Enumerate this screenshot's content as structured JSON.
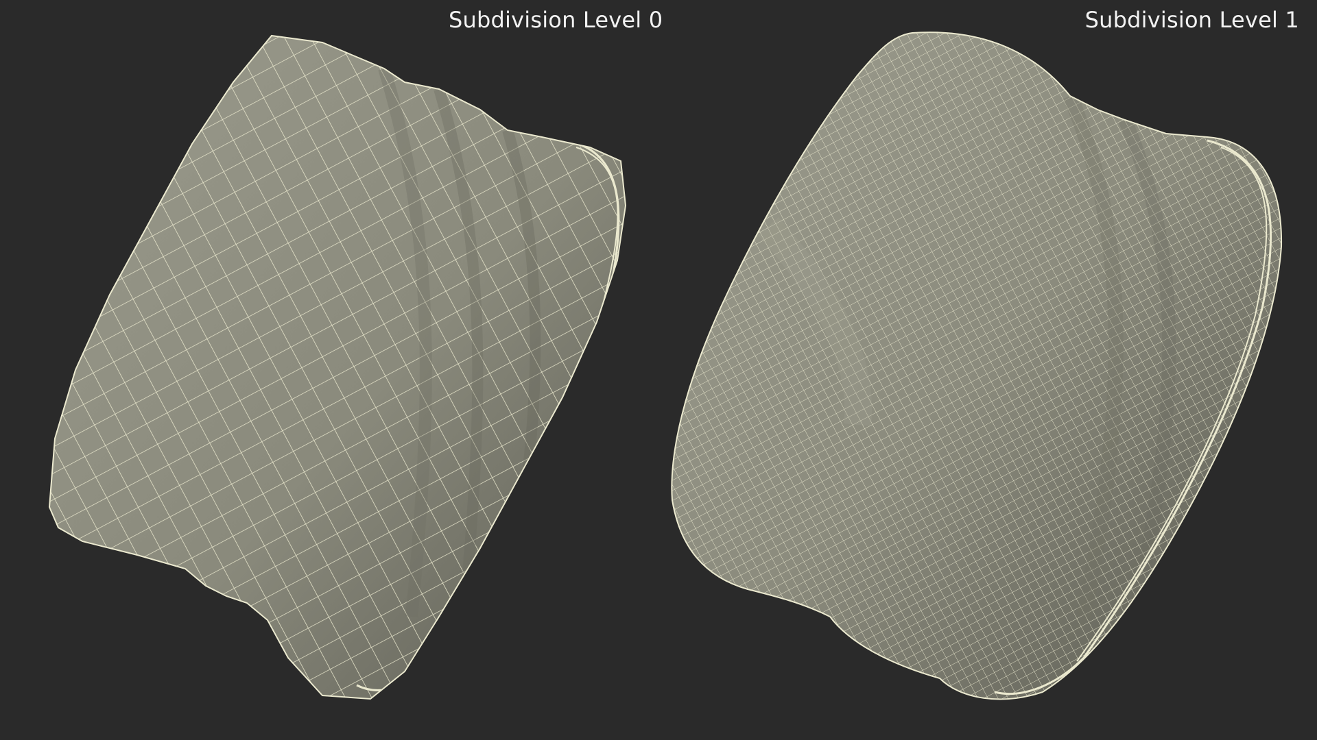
{
  "panels": [
    {
      "label": "Subdivision Level 0"
    },
    {
      "label": "Subdivision Level 1"
    }
  ],
  "colors": {
    "background": "#2a2a2a",
    "surface": "#8d8d80",
    "surface_shadow": "#5f5f56",
    "wire": "#e8e6cc",
    "label": "#f2f2f2"
  }
}
